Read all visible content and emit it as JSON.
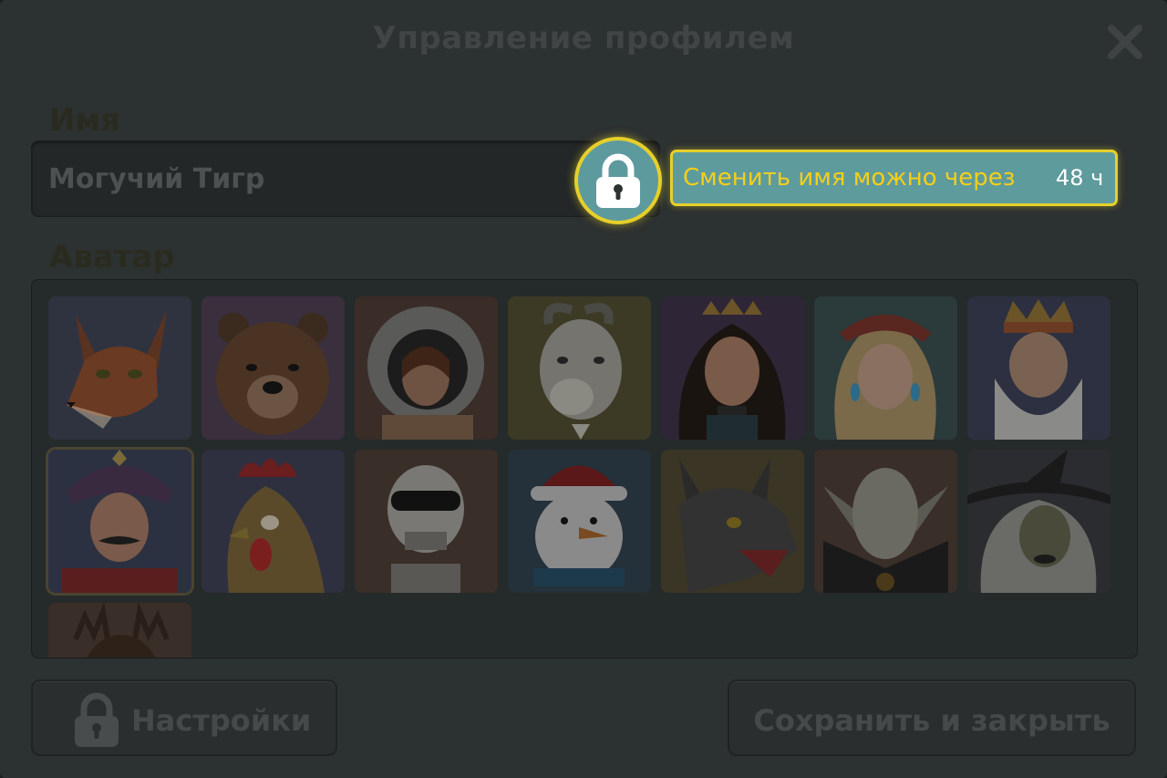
{
  "dialog": {
    "title": "Управление профилем",
    "close_icon": "close-icon"
  },
  "name_section": {
    "label": "Имя",
    "value": "Могучий Тигр",
    "lock_icon": "lock-icon"
  },
  "tooltip": {
    "message": "Сменить имя можно через",
    "time": "48 ч"
  },
  "avatar_section": {
    "label": "Аватар",
    "avatars": [
      "fox",
      "bear",
      "astronaut",
      "goat",
      "queen",
      "blonde-girl",
      "king",
      "hussar",
      "rooster",
      "skeleton",
      "snowman",
      "wolf",
      "vampire",
      "witch",
      "deer"
    ],
    "selected": "hussar"
  },
  "footer": {
    "settings_label": "Настройки",
    "settings_icon": "lock-icon",
    "save_label": "Сохранить и закрыть"
  },
  "colors": {
    "accent_yellow": "#e6cf2a",
    "tooltip_bg": "#5e9b9d",
    "tooltip_text": "#f5cf1a"
  }
}
